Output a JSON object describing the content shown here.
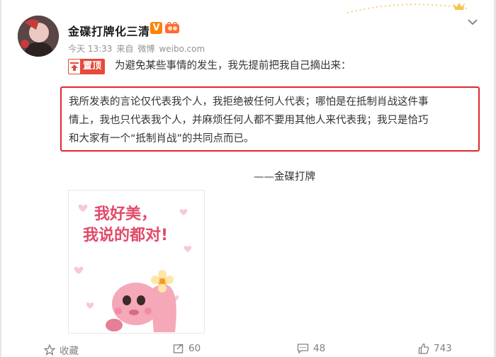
{
  "post": {
    "author": "金碟打牌化三清",
    "vip_badge": "V",
    "timestamp": "今天 13:33",
    "source_prefix": "来自",
    "source_app": "微博",
    "source_url": "weibo.com",
    "pinned_label": "置顶",
    "intro_text": "为避免某些事情的发生，我先提前把我自己摘出来：",
    "quote_lines": [
      "我所发表的言论仅代表我个人，我拒绝被任何人代表；哪怕是在抵制肖战这件事",
      "情上，我也只代表我个人，并麻烦任何人都不要用其他人来代表我；我只是恰巧",
      "和大家有一个“抵制肖战”的共同点而已。"
    ],
    "signature": "——金碟打牌",
    "sticker_text_line1": "我好美，",
    "sticker_text_line2": "我说的都对!"
  },
  "actions": {
    "favorite_label": "收藏",
    "repost_count": "60",
    "comment_count": "48",
    "like_count": "743"
  },
  "icons": {
    "favorite": "star-icon",
    "repost": "repost-icon",
    "comment": "comment-icon",
    "like": "thumb-up-icon",
    "menu": "chevron-down-icon"
  },
  "colors": {
    "quote_border": "#e3262f",
    "pin_red": "#e64a3c",
    "vip_orange": "#ff8200",
    "meta_gray": "#939393"
  }
}
